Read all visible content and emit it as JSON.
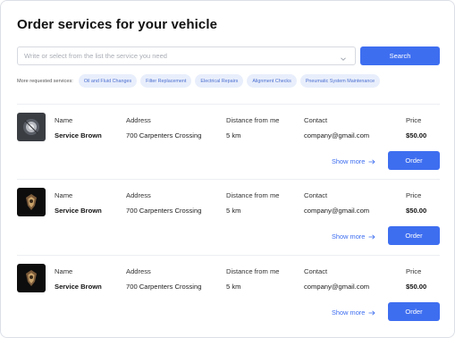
{
  "page": {
    "title": "Order services  for  your  vehicle"
  },
  "search": {
    "placeholder": "Write or select from the list the service you need",
    "button_label": "Search",
    "dropdown_icon": "chevron-down-icon"
  },
  "requested": {
    "label": "More requested services:",
    "chips": [
      "Oil and Fluid Changes",
      "Filter Replacement",
      "Electrical Repairs",
      "Alignment Checks",
      "Pneumatic System Maintenance"
    ]
  },
  "columns": {
    "name": "Name",
    "address": "Address",
    "distance": "Distance from me",
    "contact": "Contact",
    "price": "Price"
  },
  "services": [
    {
      "thumbnail_icon": "service-logo-icon",
      "name": "Service Brown",
      "address": "700 Carpenters Crossing",
      "distance": "5 km",
      "contact": "company@gmail.com",
      "price": "$50.00",
      "show_more": "Show more",
      "order": "Order"
    },
    {
      "thumbnail_icon": "service-logo-icon",
      "name": "Service Brown",
      "address": "700 Carpenters Crossing",
      "distance": "5 km",
      "contact": "company@gmail.com",
      "price": "$50.00",
      "show_more": "Show more",
      "order": "Order"
    },
    {
      "thumbnail_icon": "service-logo-icon",
      "name": "Service Brown",
      "address": "700 Carpenters Crossing",
      "distance": "5 km",
      "contact": "company@gmail.com",
      "price": "$50.00",
      "show_more": "Show more",
      "order": "Order"
    }
  ],
  "colors": {
    "accent": "#3e6ef0",
    "chip_bg": "#e8eefb",
    "chip_text": "#4b6fd1"
  }
}
